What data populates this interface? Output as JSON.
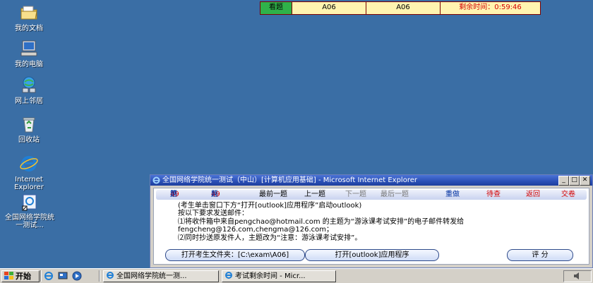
{
  "desktop": {
    "icons": [
      {
        "label": "我的文档"
      },
      {
        "label": "我的电脑"
      },
      {
        "label": "网上邻居"
      },
      {
        "label": "回收站"
      },
      {
        "label": "Internet Explorer"
      },
      {
        "label": "全国网络学院统一测试..."
      }
    ]
  },
  "exam_bar": {
    "tab": "看题",
    "field1": "A06",
    "field2": "A06",
    "remaining_label": "剩余时间：",
    "remaining_time": "0:59:46"
  },
  "window": {
    "title": "全国网络学院统一测试（中山）[计算机应用基础] - Microsoft Internet Explorer",
    "nav": {
      "current_prefix": "第",
      "current_num": "49",
      "current_suffix": "题",
      "total_prefix": "共",
      "total_num": "49",
      "total_suffix": "题",
      "first": "最前一题",
      "prev": "上一题",
      "next": "下一题",
      "last": "最后一题",
      "redo": "重做",
      "pending": "待查",
      "back": "返回",
      "submit": "交卷"
    },
    "question_lines": [
      "(考生单击窗口下方“打开[outlook]应用程序”启动outlook)",
      "按以下要求发送邮件：",
      "⑴将收件箱中来自pengchao@hotmail.com 的主题为“游泳课考试安排”的电子邮件转发给",
      "fengcheng@126.com,chengma@126.com；",
      "⑵同时抄送原发件人，主题改为“注意：游泳课考试安排”。"
    ],
    "buttons": {
      "open_folder": "打开考生文件夹：[C:\\exam\\A06]",
      "open_app": "打开[outlook]应用程序",
      "score": "评 分"
    }
  },
  "taskbar": {
    "start": "开始",
    "tasks": [
      {
        "label": "全国网络学院统一测..."
      },
      {
        "label": "考试剩余时间 - Micr..."
      }
    ]
  },
  "colors": {
    "desktop": "#3a6ea5",
    "exam_tab_green": "#2fb24a",
    "exam_bar_yellow": "#fff4b0",
    "title_blue": "#2a4fb6",
    "nav_red": "#d40000",
    "nav_blue": "#0030a0"
  }
}
